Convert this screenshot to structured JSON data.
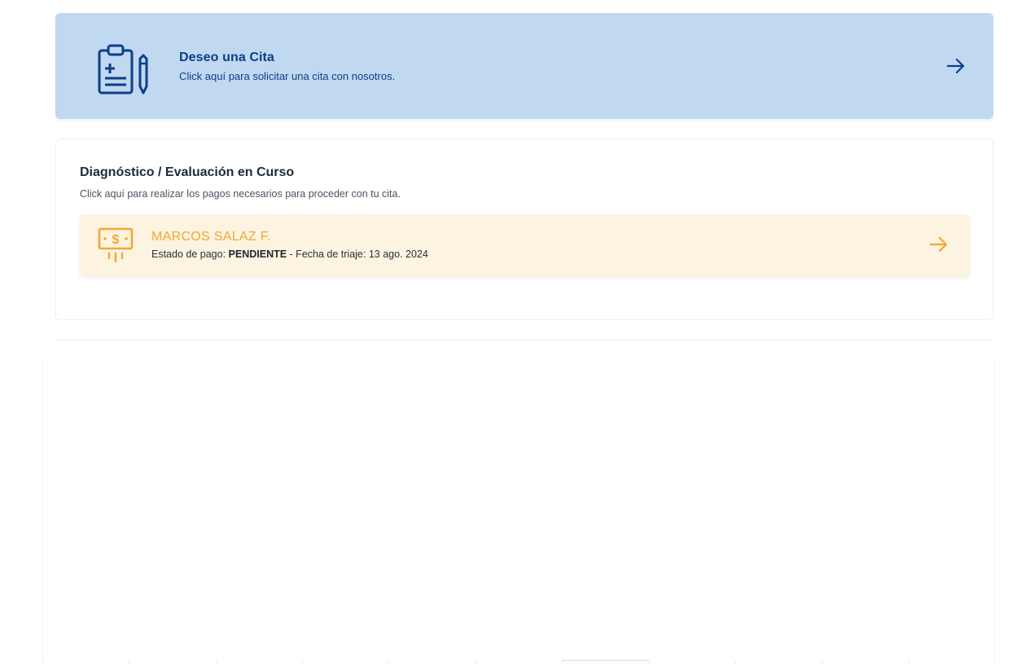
{
  "cita_card": {
    "title": "Deseo una Cita",
    "subtitle": "Click aquí para solicitar una cita con nosotros.",
    "icon": "clipboard-medical-icon",
    "arrow_icon": "arrow-right-icon",
    "color": "#0d3e8a",
    "background": "#c0d8f0"
  },
  "diagnostic": {
    "title": "Diagnóstico / Evaluación en Curso",
    "subtitle": "Click aquí para realizar los pagos necesarios para proceder con tu cita.",
    "payment_item": {
      "patient_name": "MARCOS SALAZ F.",
      "status_label": "Estado de pago: ",
      "status_value": "PENDIENTE",
      "triage_label": " - Fecha de triaje: ",
      "triage_date": "13 ago. 2024",
      "icon": "payment-money-icon",
      "arrow_icon": "arrow-right-icon",
      "accent_color": "#f0a830",
      "background": "#fdf3e1"
    }
  }
}
